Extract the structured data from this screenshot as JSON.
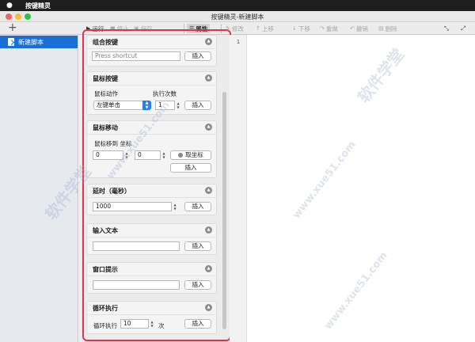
{
  "menubar": {
    "apple_icon": "apple-logo-icon",
    "app_name": "按键精灵"
  },
  "window": {
    "title": "按键精灵-新建脚本",
    "traffic_colors": {
      "close": "#fe5f57",
      "minimize": "#febc2e",
      "zoom": "#28c840"
    }
  },
  "toolbar": {
    "add": "+",
    "run": "运行",
    "stop": "停止",
    "save": "保存",
    "properties": "属性",
    "edit": "修改",
    "move_up": "上移",
    "move_down": "下移",
    "redo": "重做",
    "undo": "撤销",
    "delete": "删除"
  },
  "sidebar": {
    "items": [
      {
        "label": "新建脚本",
        "selected": true
      }
    ]
  },
  "panel": {
    "combo_key": {
      "title": "组合按键",
      "shortcut_placeholder": "Press shortcut",
      "insert": "插入"
    },
    "mouse_key": {
      "title": "鼠标按键",
      "action_label": "鼠标动作",
      "count_label": "执行次数",
      "action_value": "左键单击",
      "count_value": "1",
      "insert": "插入"
    },
    "mouse_move": {
      "title": "鼠标移动",
      "move_to_label": "鼠标移到 坐标",
      "x_value": "0",
      "y_value": "0",
      "get_coord": "取坐标",
      "insert": "插入"
    },
    "delay": {
      "title": "延时（毫秒）",
      "value": "1000",
      "insert": "插入"
    },
    "input_text": {
      "title": "输入文本",
      "value": "",
      "insert": "插入"
    },
    "window_tip": {
      "title": "窗口提示",
      "value": "",
      "insert": "插入"
    },
    "loop": {
      "title": "循环执行",
      "label": "循环执行",
      "value": "10",
      "unit": "次",
      "insert": "插入"
    }
  },
  "editor": {
    "line_numbers": [
      "1"
    ]
  },
  "watermark": {
    "text_cn": "软件学堂",
    "text_url": "www.xue51.com"
  },
  "colors": {
    "accent": "#1a6fd6",
    "highlight_box": "#e1314e"
  }
}
